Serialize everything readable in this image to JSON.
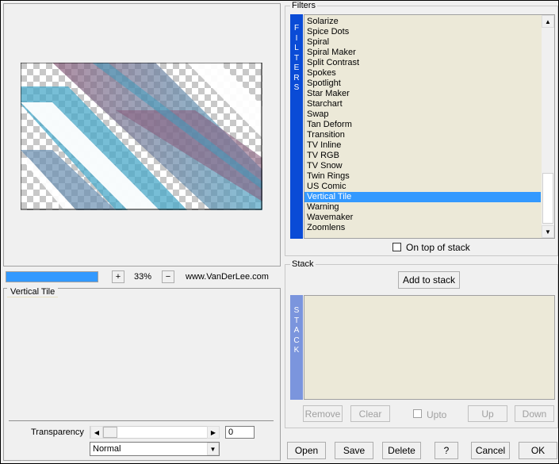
{
  "preview": {
    "zoom_value": "33%",
    "zoom_plus": "+",
    "zoom_minus": "−",
    "website": "www.VanDerLee.com",
    "progress": 1.0
  },
  "filter_settings": {
    "title": "Vertical Tile"
  },
  "transparency": {
    "label": "Transparency",
    "value": "0",
    "blend_selected": "Normal",
    "slider_level": 0.1
  },
  "filters": {
    "title": "Filters",
    "vertical_tab": [
      "F",
      "I",
      "L",
      "T",
      "E",
      "R",
      "S"
    ],
    "items": [
      "Solarize",
      "Spice Dots",
      "Spiral",
      "Spiral Maker",
      "Split Contrast",
      "Spokes",
      "Spotlight",
      "Star Maker",
      "Starchart",
      "Swap",
      "Tan Deform",
      "Transition",
      "TV Inline",
      "TV RGB",
      "TV Snow",
      "Twin Rings",
      "US Comic",
      "Vertical Tile",
      "Warning",
      "Wavemaker",
      "Zoomlens"
    ],
    "selected_index": 17,
    "on_top_label": "On top of stack"
  },
  "stack": {
    "title": "Stack",
    "add_label": "Add to stack",
    "vertical_tab": [
      "S",
      "T",
      "A",
      "C",
      "K"
    ],
    "remove_label": "Remove",
    "clear_label": "Clear",
    "upto_label": "Upto",
    "up_label": "Up",
    "down_label": "Down"
  },
  "footer": {
    "open_label": "Open",
    "save_label": "Save",
    "delete_label": "Delete",
    "help_label": "?",
    "cancel_label": "Cancel",
    "ok_label": "OK"
  },
  "colors": {
    "accent_blue": "#0a4bd6",
    "stack_tab": "#7b95dd",
    "selection": "#3399ff",
    "list_bg": "#ece9d8",
    "progress": "#3399ff"
  }
}
